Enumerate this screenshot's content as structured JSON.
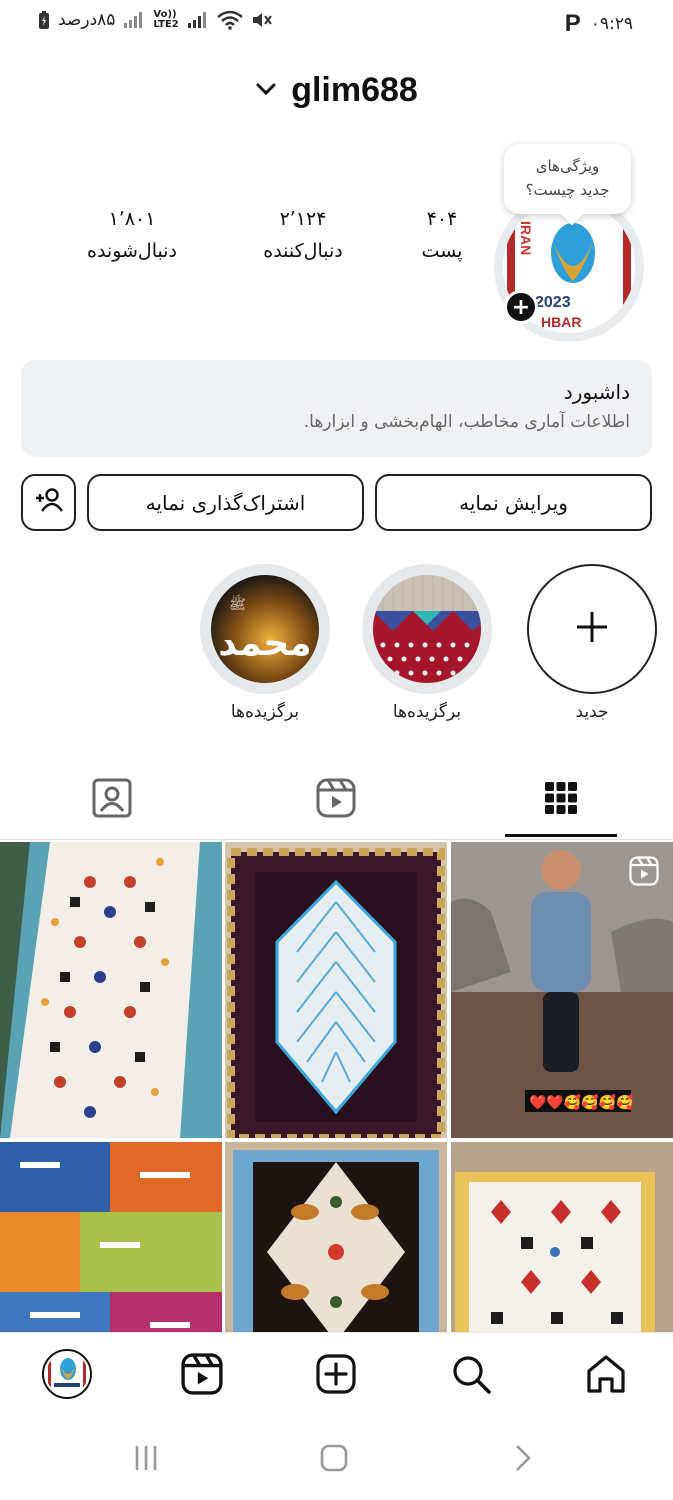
{
  "status_bar": {
    "battery_text": "۸۵درصد",
    "network_label": "Vo)) LTE2",
    "time": "۰۹:۲۹",
    "app_letter": "P"
  },
  "header": {
    "username": "glim688"
  },
  "profile": {
    "tooltip_line1": "ویژگی‌های",
    "tooltip_line2": "جدید چیست؟",
    "avatar_text_top": "IRAN",
    "avatar_text_year": "2023",
    "avatar_text_bottom": "HBAR",
    "stats": {
      "posts": {
        "value": "۴۰۴",
        "label": "پست"
      },
      "following": {
        "value": "۲٬۱۲۴",
        "label": "دنبال‌کننده"
      },
      "followers": {
        "value": "۱٬۸۰۱",
        "label": "دنبال‌شونده"
      }
    }
  },
  "dashboard": {
    "title": "داشبورد",
    "subtitle": "اطلاعات آماری مخاطب، الهام‌بخشی و ابزارها."
  },
  "buttons": {
    "edit_profile": "ویرایش نمایه",
    "share_profile": "اشتراک‌گذاری نمایه"
  },
  "highlights": [
    {
      "label": "جدید"
    },
    {
      "label": "برگزیده‌ها"
    },
    {
      "label": "برگزیده‌ها"
    }
  ],
  "highlight_calligraphy": "محمد",
  "grid_overlay_text": "❤️❤️🥰🥰🥰🥰",
  "colors": {
    "accent": "#111111",
    "surface": "#eff1f4",
    "muted_text": "#666666"
  }
}
